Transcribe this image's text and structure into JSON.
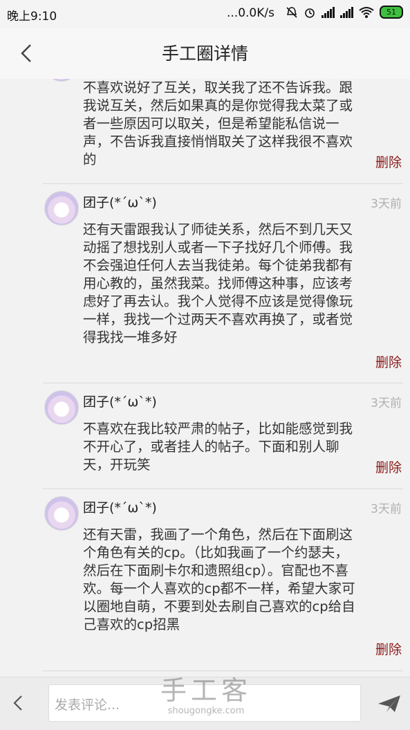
{
  "status": {
    "time": "晚上9:10",
    "net_speed": "...0.0K/s",
    "battery": "51"
  },
  "header": {
    "title": "手工圈详情"
  },
  "comments": [
    {
      "name": "",
      "time": "",
      "text": "不喜欢说好了互关，取关我了还不告诉我。跟我说互关，然后如果真的是你觉得我太菜了或者一些原因可以取关，但是希望能私信说一声，不告诉我直接悄悄取关了这样我很不喜欢的",
      "delete_label": "删除"
    },
    {
      "name": "团子(*´ω`*)",
      "time": "3天前",
      "text": "还有天雷跟我认了师徒关系，然后不到几天又动摇了想找别人或者一下子找好几个师傅。我不会强迫任何人去当我徒弟。每个徒弟我都有用心教的，虽然我菜。找师傅这种事，应该考虑好了再去认。我个人觉得不应该是觉得像玩一样，我找一个过两天不喜欢再换了，或者觉得我找一堆多好",
      "delete_label": "删除"
    },
    {
      "name": "团子(*´ω`*)",
      "time": "3天前",
      "text": "不喜欢在我比较严肃的帖子，比如能感觉到我不开心了，或者挂人的帖子。下面和别人聊天，开玩笑",
      "delete_label": "删除"
    },
    {
      "name": "团子(*´ω`*)",
      "time": "3天前",
      "text": "还有天雷，我画了一个角色，然后在下面刷这个角色有关的cp。（比如我画了一个约瑟夫，然后在下面刷卡尔和遗照组cp）。官配也不喜欢。每一个人喜欢的cp都不一样，希望大家可以圈地自萌，不要到处去刷自己喜欢的cp给自己喜欢的cp招黑",
      "delete_label": "删除"
    }
  ],
  "footer": {
    "input_placeholder": "发表评论..."
  },
  "watermark": {
    "big": "手工客",
    "small": "shougongke.com"
  }
}
